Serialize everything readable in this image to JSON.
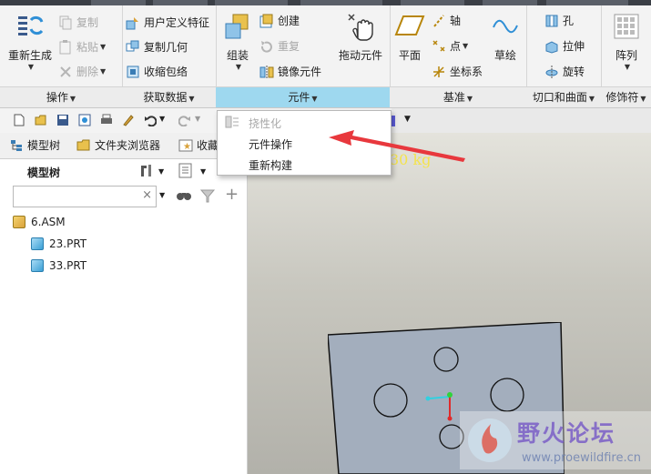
{
  "ribbon": {
    "groups": [
      {
        "label": "操作",
        "buttons": [
          {
            "label": "重新生成",
            "icon": "regenerate-icon"
          },
          {
            "label": "复制",
            "icon": "copy-icon",
            "disabled": true
          },
          {
            "label": "粘贴",
            "icon": "paste-icon",
            "disabled": true
          },
          {
            "label": "删除",
            "icon": "delete-icon",
            "disabled": true
          }
        ]
      },
      {
        "label": "获取数据",
        "buttons": [
          {
            "label": "用户定义特征",
            "icon": "udf-icon"
          },
          {
            "label": "复制几何",
            "icon": "copy-geometry-icon"
          },
          {
            "label": "收缩包络",
            "icon": "shrinkwrap-icon"
          }
        ]
      },
      {
        "label": "元件",
        "active": true,
        "buttons": [
          {
            "label": "组装",
            "icon": "assemble-icon"
          },
          {
            "label": "创建",
            "icon": "create-icon"
          },
          {
            "label": "重复",
            "icon": "repeat-icon",
            "disabled": true
          },
          {
            "label": "镜像元件",
            "icon": "mirror-component-icon"
          },
          {
            "label": "拖动元件",
            "icon": "drag-component-icon"
          }
        ]
      },
      {
        "label": "基准",
        "buttons": [
          {
            "label": "平面",
            "icon": "plane-icon"
          },
          {
            "label": "轴",
            "icon": "axis-icon"
          },
          {
            "label": "点",
            "icon": "point-icon"
          },
          {
            "label": "坐标系",
            "icon": "csys-icon"
          },
          {
            "label": "草绘",
            "icon": "sketch-icon"
          }
        ]
      },
      {
        "label": "切口和曲面",
        "buttons": [
          {
            "label": "孔",
            "icon": "hole-icon"
          },
          {
            "label": "拉伸",
            "icon": "extrude-icon"
          },
          {
            "label": "旋转",
            "icon": "revolve-icon"
          }
        ]
      },
      {
        "label": "修饰符",
        "buttons": [
          {
            "label": "阵列",
            "icon": "pattern-icon"
          }
        ]
      }
    ]
  },
  "menu": {
    "items": [
      {
        "label": "挠性化",
        "disabled": true
      },
      {
        "label": "元件操作",
        "disabled": false
      },
      {
        "label": "重新构建",
        "disabled": false
      }
    ]
  },
  "panel": {
    "tabs": [
      {
        "label": "模型树"
      },
      {
        "label": "文件夹浏览器"
      },
      {
        "label": "收藏"
      }
    ],
    "title": "模型树",
    "search": {
      "value": "",
      "clear": "×"
    },
    "tree": [
      {
        "label": "6.ASM",
        "level": 0
      },
      {
        "label": "23.PRT",
        "level": 1
      },
      {
        "label": "33.PRT",
        "level": 1
      }
    ]
  },
  "viewport": {
    "mass_label": "30 kg"
  },
  "watermark": {
    "title": "野火论坛",
    "url": "www.proewildfire.cn"
  },
  "colors": {
    "active_group": "#9ed8ef",
    "annotation_arrow": "#e8383d",
    "part_face": "#a3aebd",
    "mass_text": "#f4e34d"
  }
}
